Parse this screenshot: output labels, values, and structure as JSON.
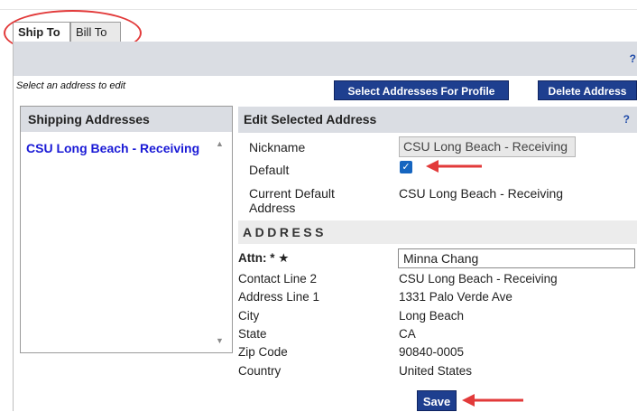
{
  "tabs": [
    {
      "label": "Ship To",
      "active": true
    },
    {
      "label": "Bill To",
      "active": false
    }
  ],
  "band": {
    "help_glyph": "?"
  },
  "select_prompt": "Select an address to edit",
  "buttons": {
    "select_addresses": "Select Addresses For Profile",
    "delete_address": "Delete Address",
    "save": "Save"
  },
  "shipping_panel": {
    "heading": "Shipping Addresses",
    "items": [
      "CSU Long Beach - Receiving"
    ]
  },
  "edit_panel": {
    "heading": "Edit Selected Address",
    "help_glyph": "?",
    "nickname_label": "Nickname",
    "nickname_value": "CSU Long Beach - Receiving",
    "default_label": "Default",
    "default_checked": true,
    "current_default_label_1": "Current Default",
    "current_default_label_2": "Address",
    "current_default_value": "CSU Long Beach - Receiving"
  },
  "address": {
    "section_title": "ADDRESS",
    "attn_label": "Attn: * ★",
    "attn_value": "Minna Chang",
    "rows": [
      {
        "label": "Contact Line 2",
        "value": "CSU Long Beach - Receiving"
      },
      {
        "label": "Address Line 1",
        "value": "1331 Palo Verde Ave"
      },
      {
        "label": "City",
        "value": "Long Beach"
      },
      {
        "label": "State",
        "value": "CA"
      },
      {
        "label": "Zip Code",
        "value": "90840-0005"
      },
      {
        "label": "Country",
        "value": "United States"
      }
    ]
  },
  "colors": {
    "accent_button": "#1e3f8f",
    "link_blue": "#1a1ad6",
    "annotation_red": "#e23a3a",
    "panel_gray": "#dadde3"
  }
}
